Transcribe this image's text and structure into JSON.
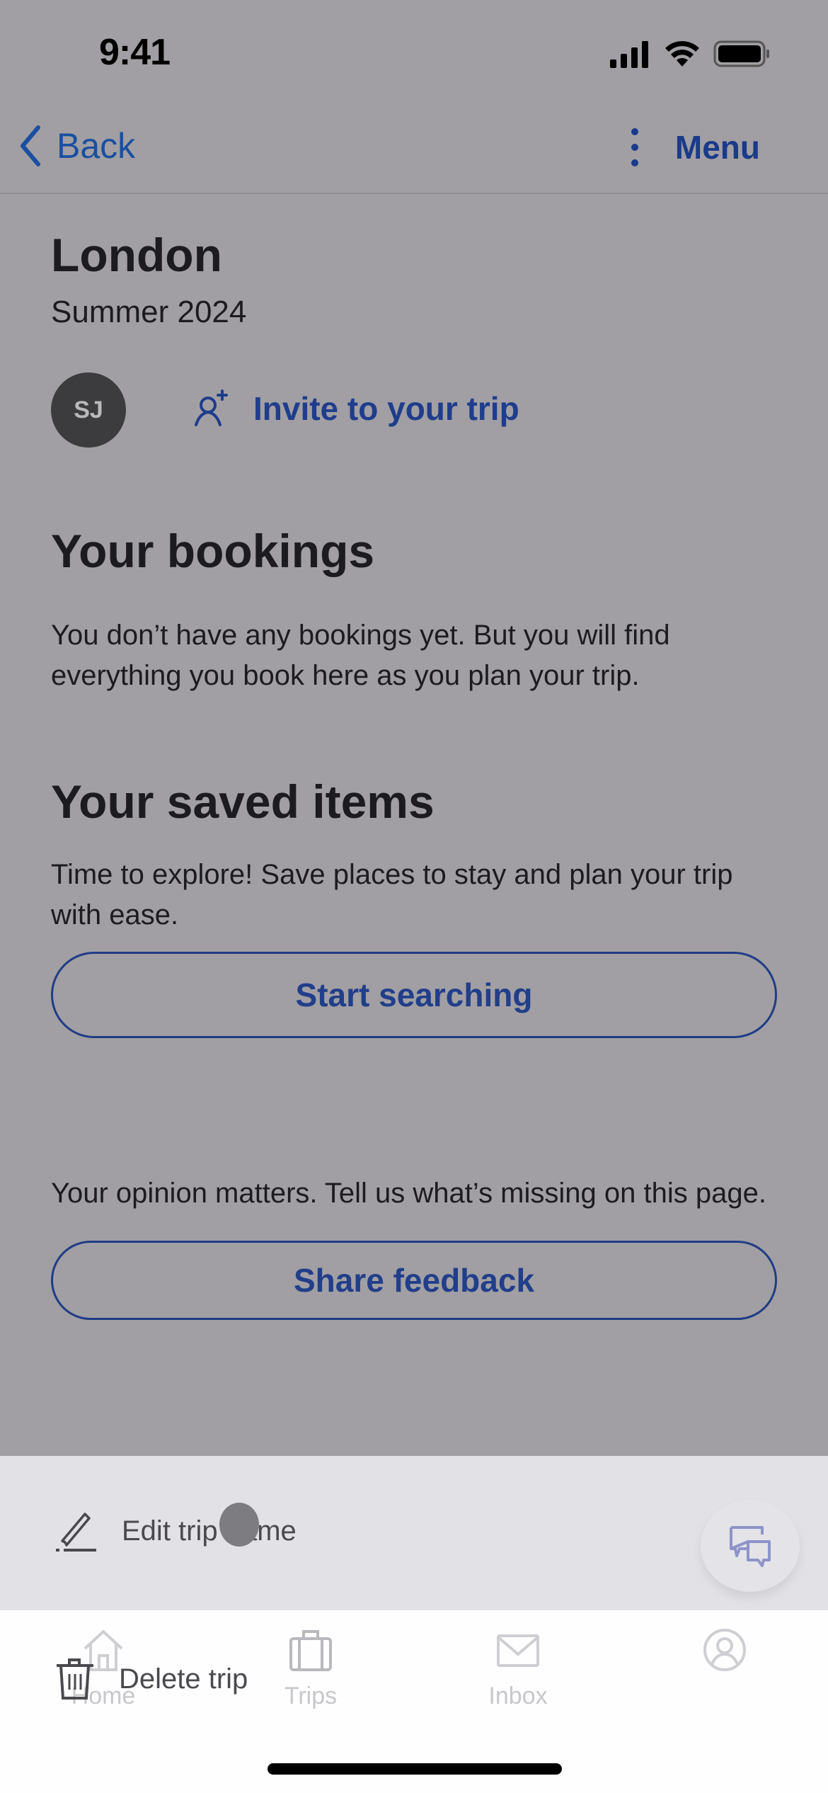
{
  "status_bar": {
    "time": "9:41",
    "icons": [
      "cellular-signal-icon",
      "wifi-icon",
      "battery-icon"
    ]
  },
  "nav": {
    "back_label": "Back",
    "back_icon": "chevron-left-icon",
    "menu_label": "Menu",
    "menu_icon": "more-vertical-icon"
  },
  "trip": {
    "title": "London",
    "subtitle": "Summer 2024",
    "avatar_initials": "SJ",
    "invite_label": "Invite to your trip",
    "invite_icon": "add-person-icon"
  },
  "bookings": {
    "heading": "Your bookings",
    "body": "You don’t have any bookings yet. But you will find everything you book here as you plan your trip."
  },
  "saved": {
    "heading": "Your saved items",
    "body": "Time to explore! Save places to stay and plan your trip with ease.",
    "button_label": "Start searching"
  },
  "feedback": {
    "body": "Your opinion matters. Tell us what’s missing on this page.",
    "button_label": "Share feedback"
  },
  "action_sheet": {
    "items": [
      {
        "label": "Edit trip name",
        "icon": "pencil-icon"
      },
      {
        "label": "Delete trip",
        "icon": "trash-icon"
      }
    ],
    "fab_icon": "chat-bubbles-icon"
  },
  "tab_bar": {
    "tabs": [
      {
        "label": "Home",
        "icon": "home-icon"
      },
      {
        "label": "Trips",
        "icon": "suitcase-icon"
      },
      {
        "label": "Inbox",
        "icon": "mail-icon"
      },
      {
        "label": "",
        "icon": "account-icon"
      }
    ]
  },
  "colors": {
    "overlay_bg": "#a19fa3",
    "accent_blue": "#1f3d8c",
    "sheet_bg": "#e2e1e6",
    "tab_bar_bg": "#fefefe"
  }
}
